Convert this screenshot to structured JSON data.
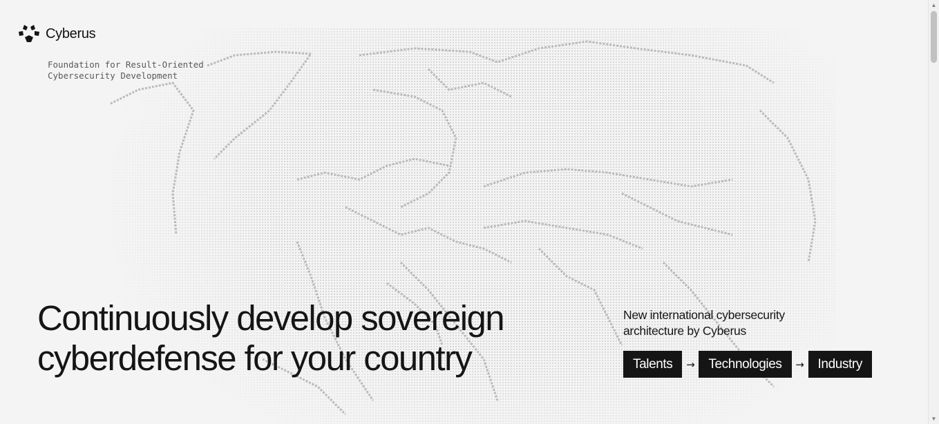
{
  "brand": {
    "name": "Cyberus",
    "tagline": "Foundation for Result-Oriented\nCybersecurity Development",
    "logo_icon": "cyberus-logo-icon"
  },
  "hero": {
    "headline": "Continuously develop sovereign cyberdefense for your country",
    "subheadline": "New international cybersecurity architecture by Cyberus"
  },
  "pipeline": {
    "steps": [
      "Talents",
      "Technologies",
      "Industry"
    ],
    "arrow_icon": "arrow-right-icon"
  },
  "colors": {
    "background": "#f4f4f4",
    "text": "#151515",
    "chip_background": "#151515",
    "chip_text": "#ffffff",
    "map_dots": "#c9c9c9"
  }
}
